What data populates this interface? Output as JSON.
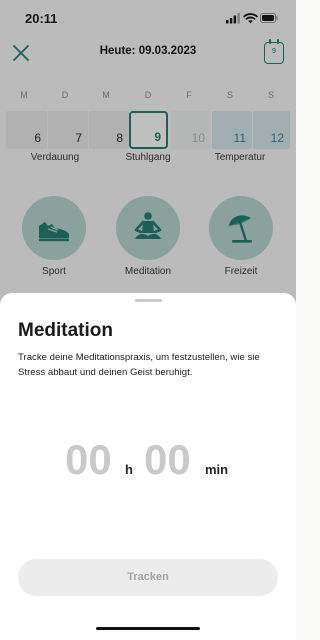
{
  "status_bar": {
    "time": "20:11"
  },
  "header": {
    "title": "Heute: 09.03.2023",
    "calendar_day": "9"
  },
  "weekdays": [
    "M",
    "D",
    "M",
    "D",
    "F",
    "S",
    "S"
  ],
  "days": [
    {
      "num": "6",
      "state": "normal"
    },
    {
      "num": "7",
      "state": "normal"
    },
    {
      "num": "8",
      "state": "normal"
    },
    {
      "num": "9",
      "state": "selected"
    },
    {
      "num": "10",
      "state": "future"
    },
    {
      "num": "11",
      "state": "weekend"
    },
    {
      "num": "12",
      "state": "weekend"
    }
  ],
  "categories": [
    "Verdauung",
    "Stuhlgang",
    "Temperatur"
  ],
  "tiles": [
    {
      "label": "Sport",
      "icon": "sneaker-icon"
    },
    {
      "label": "Meditation",
      "icon": "meditation-icon"
    },
    {
      "label": "Freizeit",
      "icon": "beach-umbrella-icon"
    }
  ],
  "sheet": {
    "title": "Meditation",
    "description": "Tracke deine Meditationspraxis, um festzustellen, wie sie Stress abbaut und deinen Geist beruhigt.",
    "hours": "00",
    "hours_unit": "h",
    "minutes": "00",
    "minutes_unit": "min",
    "button_label": "Tracken"
  },
  "colors": {
    "accent": "#1f7a6e",
    "tile_bg": "#b9d6d1",
    "weekend": "#3f7e97"
  }
}
